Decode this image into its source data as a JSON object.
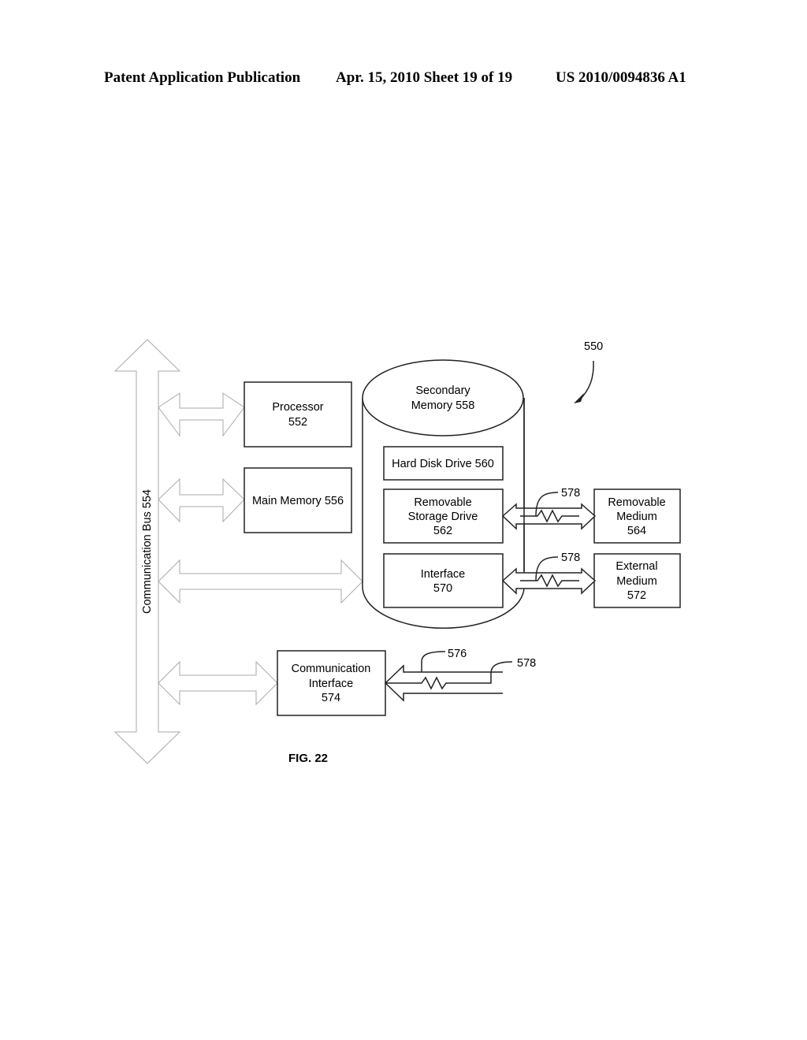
{
  "header": {
    "publication": "Patent Application Publication",
    "date_sheet": "Apr. 15, 2010  Sheet 19 of 19",
    "number": "US 2010/0094836 A1"
  },
  "diagram": {
    "reference": "550",
    "bus_label": "Communication Bus 554",
    "processor": [
      "Processor",
      "552"
    ],
    "main_memory": [
      "Main Memory 556"
    ],
    "secondary_memory": [
      "Secondary",
      "Memory 558"
    ],
    "hard_disk": [
      "Hard Disk Drive 560"
    ],
    "removable_drive": [
      "Removable",
      "Storage Drive",
      "562"
    ],
    "interface": [
      "Interface",
      "570"
    ],
    "removable_medium": [
      "Removable",
      "Medium",
      "564"
    ],
    "external_medium": [
      "External",
      "Medium",
      "572"
    ],
    "comm_interface": [
      "Communication",
      "Interface",
      "574"
    ],
    "channel_label_1": "578",
    "channel_label_2": "578",
    "channel_label_3": "578",
    "signal_label": "576",
    "figure_caption": "FIG. 22"
  }
}
